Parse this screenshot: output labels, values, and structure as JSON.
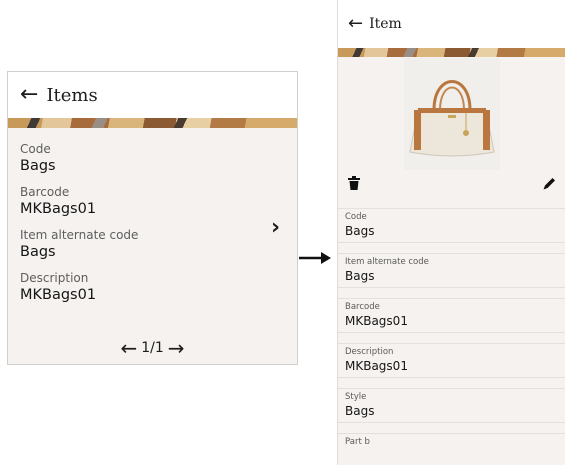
{
  "left_card": {
    "back_icon": "arrow-left-icon",
    "title": "Items",
    "fields": [
      {
        "label": "Code",
        "value": "Bags"
      },
      {
        "label": "Barcode",
        "value": "MKBags01"
      },
      {
        "label": "Item alternate code",
        "value": "Bags"
      },
      {
        "label": "Description",
        "value": "MKBags01"
      }
    ],
    "pager": {
      "text": "1/1"
    }
  },
  "right_panel": {
    "back_icon": "arrow-left-icon",
    "title": "Item",
    "image": "handbag-product-photo",
    "fields": [
      {
        "label": "Code",
        "value": "Bags"
      },
      {
        "label": "Item alternate code",
        "value": "Bags"
      },
      {
        "label": "Barcode",
        "value": "MKBags01"
      },
      {
        "label": "Description",
        "value": "MKBags01"
      },
      {
        "label": "Style",
        "value": "Bags"
      },
      {
        "label": "Part b",
        "value": ""
      }
    ]
  },
  "colors": {
    "card_background": "#f5f2ef",
    "header_background": "#ffffff",
    "text": "#1d1d1d",
    "label": "#5e5e5e"
  }
}
